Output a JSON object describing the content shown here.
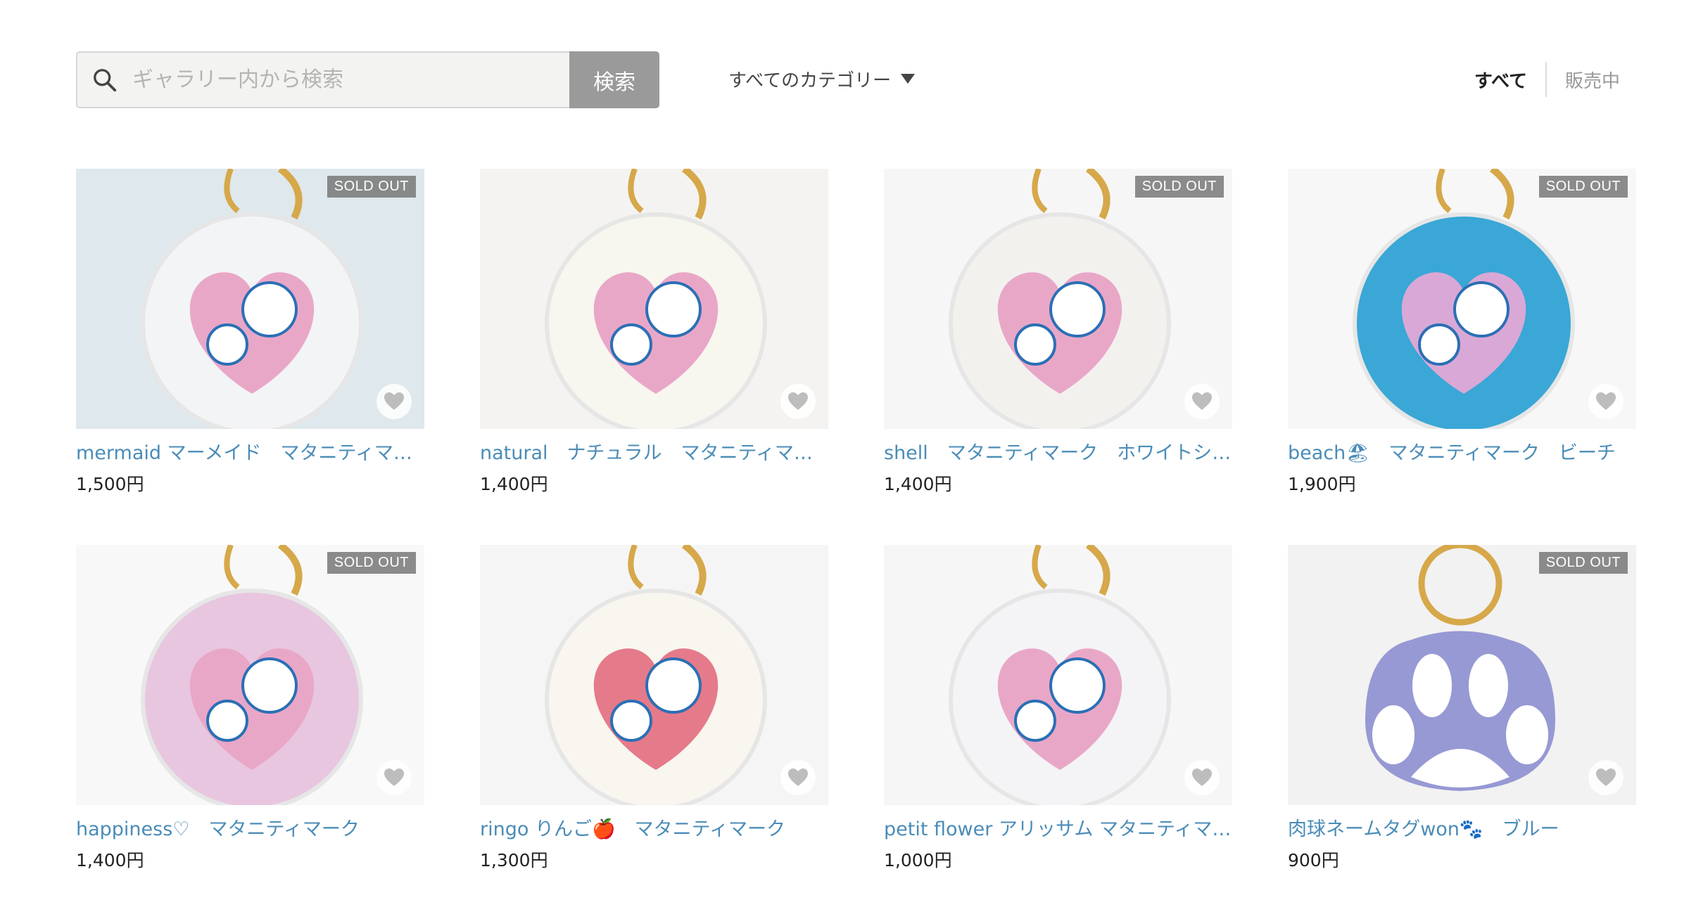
{
  "search": {
    "placeholder": "ギャラリー内から検索",
    "button_label": "検索"
  },
  "category": {
    "selected": "すべてのカテゴリー"
  },
  "filter": {
    "all_label": "すべて",
    "selling_label": "販売中"
  },
  "products": [
    {
      "title": "mermaid マーメイド　マタニティマーク　ホワイト",
      "price": "1,500円",
      "sold_out": "SOLD OUT",
      "bg": "#dfe8ec",
      "accent": "#e9a7c8",
      "charm": "#f2f4f6"
    },
    {
      "title": "natural　ナチュラル　マタニティマーク",
      "price": "1,400円",
      "sold_out": "",
      "bg": "#f4f3f1",
      "accent": "#e9a7c8",
      "charm": "#f7f6ef"
    },
    {
      "title": "shell　マタニティマーク　ホワイトシェル",
      "price": "1,400円",
      "sold_out": "SOLD OUT",
      "bg": "#f6f6f6",
      "accent": "#e9a7c8",
      "charm": "#f3f1ee"
    },
    {
      "title": "beach🏖　マタニティマーク　ビーチ",
      "price": "1,900円",
      "sold_out": "SOLD OUT",
      "bg": "#f7f7f7",
      "accent": "#d9a8d6",
      "charm": "#3aa7d6"
    },
    {
      "title": "happiness♡　マタニティマーク",
      "price": "1,400円",
      "sold_out": "SOLD OUT",
      "bg": "#f8f8f8",
      "accent": "#e9a7c8",
      "charm": "#e8c6df"
    },
    {
      "title": "ringo りんご🍎　マタニティマーク",
      "price": "1,300円",
      "sold_out": "",
      "bg": "#f5f5f5",
      "accent": "#e57a8a",
      "charm": "#f8f6ef"
    },
    {
      "title": "petit flower アリッサム マタニティマーク",
      "price": "1,000円",
      "sold_out": "",
      "bg": "#f6f6f6",
      "accent": "#e9a7c8",
      "charm": "#f4f4f6"
    },
    {
      "title": "肉球ネームタグwon🐾　ブルー",
      "price": "900円",
      "sold_out": "SOLD OUT",
      "bg": "#f2f2f2",
      "accent": "#ffffff",
      "charm": "#8d8fd0"
    }
  ]
}
